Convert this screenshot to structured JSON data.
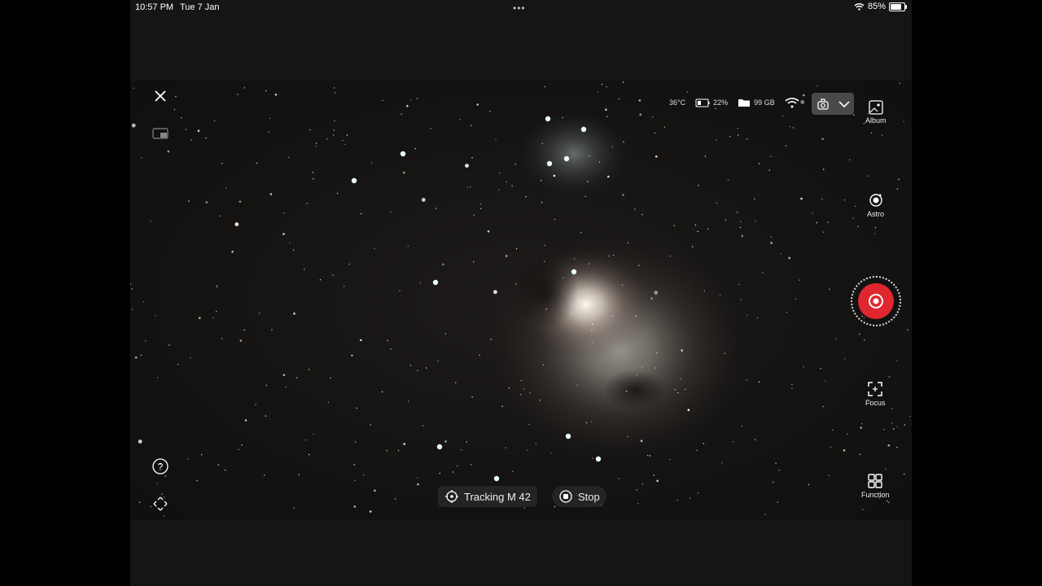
{
  "status_bar": {
    "time": "10:57 PM",
    "date": "Tue 7 Jan",
    "battery": "85%",
    "battery_level": 0.85
  },
  "top_info": {
    "temperature": "36°C",
    "device_battery": "22%",
    "storage": "99 GB"
  },
  "right_panel": {
    "album_label": "Album",
    "astro_label": "Astro",
    "focus_label": "Focus",
    "function_label": "Function"
  },
  "bottom": {
    "tracking_label": "Tracking M 42",
    "stop_label": "Stop"
  },
  "colors": {
    "shutter": "#e0262e",
    "panel_bg": "#151515"
  },
  "icons": [
    "close-icon",
    "picture-in-picture-icon",
    "help-icon",
    "move-icon",
    "thermometer-icon",
    "battery-icon",
    "folder-icon",
    "wifi-icon",
    "telescope-icon",
    "chevron-down-icon",
    "album-icon",
    "astro-icon",
    "shutter-icon",
    "focus-icon",
    "function-grid-icon",
    "crosshair-icon",
    "stop-icon"
  ]
}
